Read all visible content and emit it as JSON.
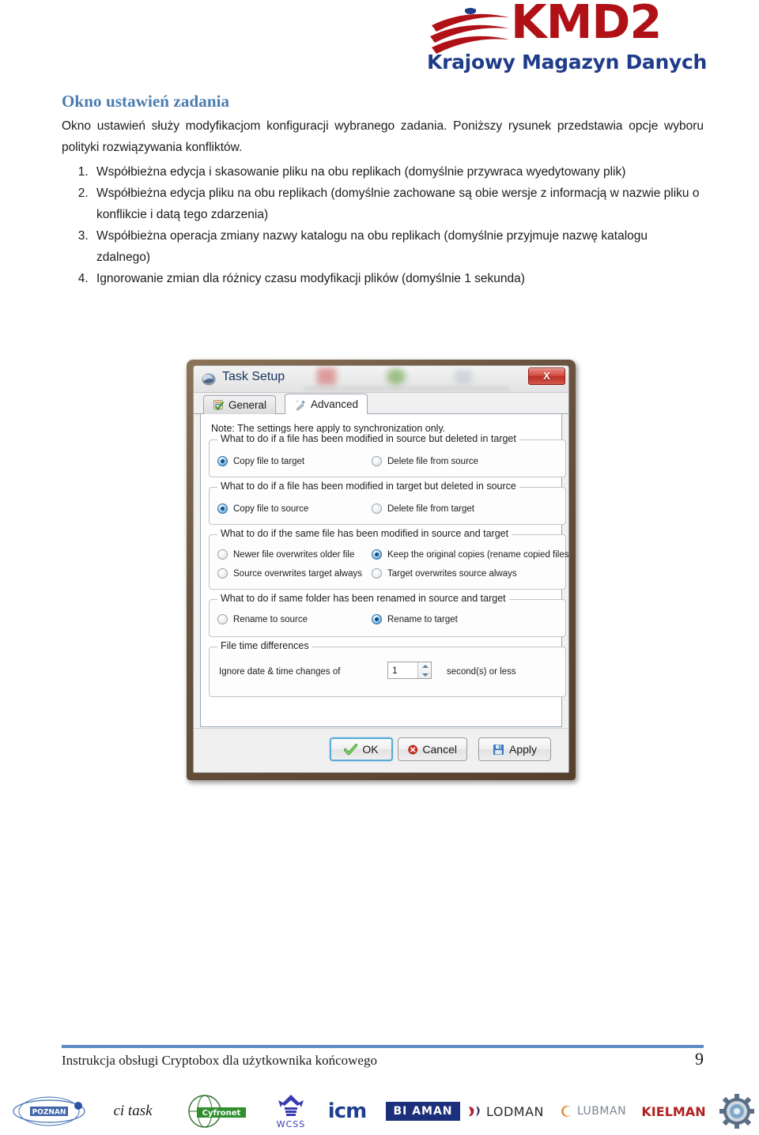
{
  "header": {
    "logo_word": "KMD2",
    "logo_subtitle": "Krajowy Magazyn Danych",
    "logo_color_word": "#b01116",
    "logo_color_subtitle": "#1f3c8a"
  },
  "content": {
    "heading": "Okno ustawień zadania",
    "heading_color": "#4a7cb0",
    "paragraph": "Okno ustawień służy modyfikacjom konfiguracji wybranego zadania. Poniższy rysunek przedstawia opcje wyboru polityki rozwiązywania konfliktów.",
    "list": [
      "Współbieżna edycja i skasowanie pliku na obu replikach (domyślnie przywraca wyedytowany plik)",
      "Współbieżna edycja pliku na obu replikach (domyślnie zachowane są obie wersje z informacją w nazwie pliku o konflikcie i datą tego zdarzenia)",
      "Współbieżna operacja zmiany nazwy katalogu na obu replikach (domyślnie przyjmuje nazwę katalogu zdalnego)",
      "Ignorowanie zmian dla różnicy czasu modyfikacji plików (domyślnie 1 sekunda)"
    ]
  },
  "dialog": {
    "title": "Task Setup",
    "title_icon": "app-window-icon",
    "close_label": "X",
    "tabs": [
      {
        "label": "General",
        "icon": "clipboard-check-icon",
        "selected": false
      },
      {
        "label": "Advanced",
        "icon": "magic-wand-icon",
        "selected": true
      }
    ],
    "note": "Note: The settings here apply to synchronization only.",
    "groups": [
      {
        "title": "What to do if a file has been modified in source but deleted in target",
        "options": [
          {
            "label": "Copy file to target",
            "selected": true
          },
          {
            "label": "Delete file from source",
            "selected": false
          }
        ]
      },
      {
        "title": "What to do if a file has been modified in target but deleted in source",
        "options": [
          {
            "label": "Copy file to source",
            "selected": true
          },
          {
            "label": "Delete file from target",
            "selected": false
          }
        ]
      },
      {
        "title": "What to do if the same file has been modified in source and target",
        "options": [
          {
            "label": "Newer file overwrites older file",
            "selected": false
          },
          {
            "label": "Keep the original copies (rename copied files)",
            "selected": true
          },
          {
            "label": "Source overwrites target always",
            "selected": false
          },
          {
            "label": "Target overwrites source always",
            "selected": false
          }
        ]
      },
      {
        "title": "What to do if same folder has been renamed in source and target",
        "options": [
          {
            "label": "Rename to source",
            "selected": false
          },
          {
            "label": "Rename to target",
            "selected": true
          }
        ]
      }
    ],
    "time_group": {
      "title": "File time differences",
      "label": "Ignore date & time changes of",
      "value": "1",
      "suffix": "second(s) or less"
    },
    "buttons": [
      {
        "label": "OK",
        "icon": "green-check-icon"
      },
      {
        "label": "Cancel",
        "icon": "red-x-circle-icon"
      },
      {
        "label": "Apply",
        "icon": "floppy-disk-icon"
      }
    ]
  },
  "footer": {
    "text": "Instrukcja obsługi Cryptobox dla użytkownika końcowego",
    "page_number": "9",
    "rule_color": "#5b8cc0"
  },
  "partner_logos": [
    {
      "name": "POZNAN",
      "id": "poznan-logo"
    },
    {
      "name": "ci task",
      "id": "citask-logo"
    },
    {
      "name": "Cyfronet",
      "id": "cyfronet-logo"
    },
    {
      "name": "WCSS",
      "id": "wcss-logo"
    },
    {
      "name": "icm",
      "id": "icm-logo"
    },
    {
      "name": "BI AMAN",
      "id": "biaman-logo"
    },
    {
      "name": "LODMAN",
      "id": "lodman-logo"
    },
    {
      "name": "LUBMAN",
      "id": "lubman-logo"
    },
    {
      "name": "KIELMAN",
      "id": "kielman-logo"
    },
    {
      "name": "gear-emblem",
      "id": "gear-logo"
    }
  ]
}
